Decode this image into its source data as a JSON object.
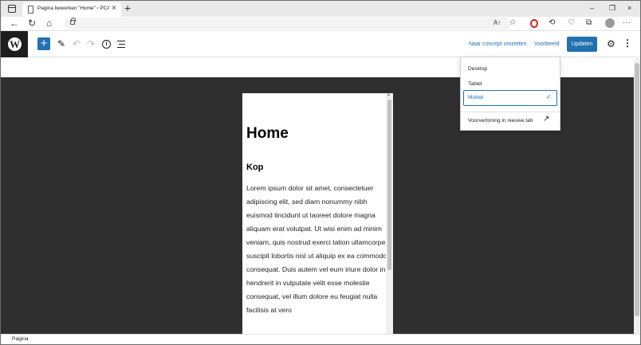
{
  "browser": {
    "tab_title": "Pagina bewerken \"Home\" ‹ PCA",
    "tab_close": "×",
    "new_tab": "+",
    "window_controls": [
      "–",
      "❐",
      "×"
    ],
    "reader_icon_text": "A↑"
  },
  "toolbar": {
    "nav_icons": [
      "←",
      "↻",
      "⌂"
    ],
    "right_icons": [
      "☆",
      "⟲",
      "♡",
      "⧉",
      "···"
    ]
  },
  "editor": {
    "wp_logo": "W",
    "add_block": "+",
    "save_draft_label": "Naar concept omzetten",
    "preview_label": "Voorbeeld",
    "update_label": "Updaten",
    "undo_icon": "↶",
    "redo_icon": "↷",
    "info_icon": "i",
    "tools_icon": "✎",
    "settings_icon": "⚙",
    "more_icon": "⋮"
  },
  "preview_menu": {
    "items": [
      "Desktop",
      "Tablet",
      "Mobiel"
    ],
    "selected": "Mobiel",
    "check": "✓",
    "new_tab_label": "Voorvertoning in nieuwe tab",
    "new_tab_icon": "↗"
  },
  "content": {
    "title": "Home",
    "heading": "Kop",
    "paragraph": "Lorem ipsum dolor sit amet, consectetuer adipiscing elit, sed diam nonummy nibh euismod tincidunt ut laoreet dolore magna aliquam erat volutpat. Ut wisi enim ad minim veniam, quis nostrud exerci tation ullamcorper suscipit lobortis nisl ut aliquip ex ea commodo consequat. Duis autem vel eum iriure dolor in hendrerit in vulputate velit esse molestie consequat, vel illum dolore eu feugiat nulla facilisis at vero"
  },
  "status": {
    "breadcrumb": "Pagina"
  },
  "colors": {
    "wp_blue": "#2271b1",
    "canvas": "#2f2f2f",
    "wp_dark": "#1e1e1e"
  }
}
